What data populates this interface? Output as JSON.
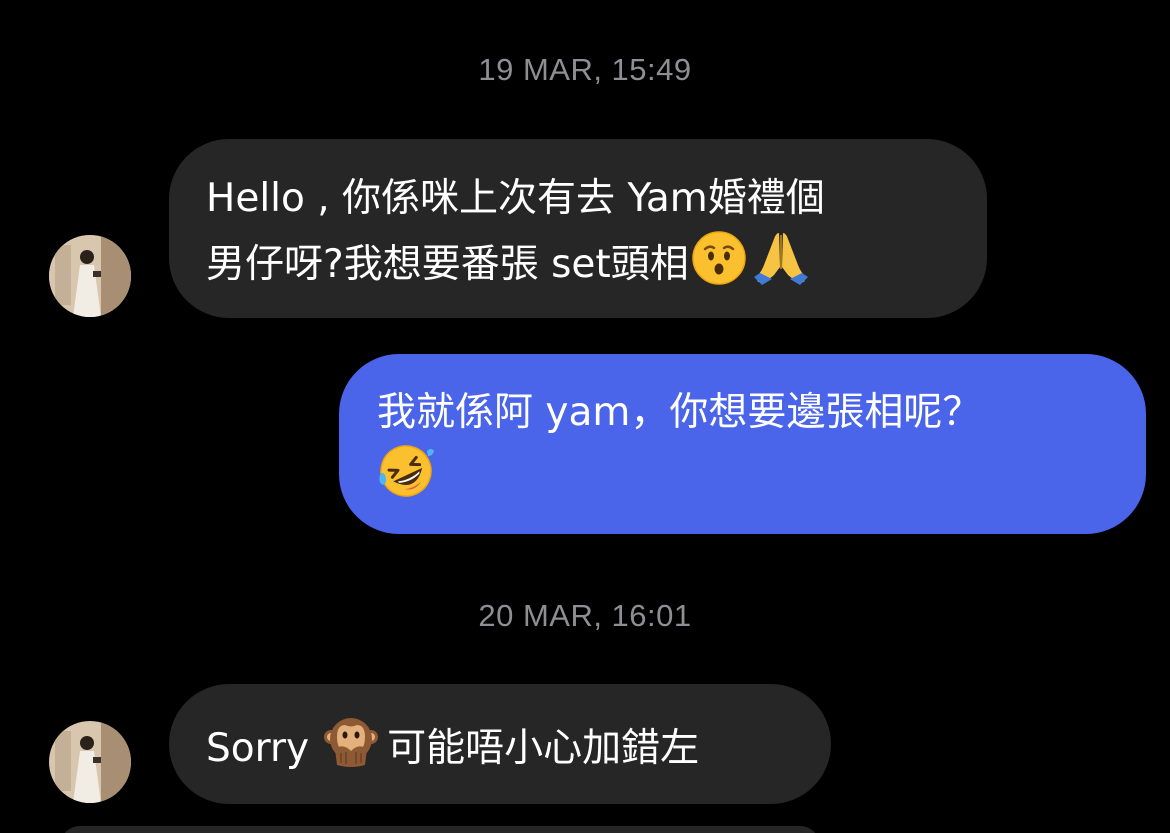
{
  "conversation": {
    "timestamps": [
      "19 MAR, 15:49",
      "20 MAR, 16:01"
    ],
    "messages": [
      {
        "direction": "incoming",
        "line1": "Hello , 你係咪上次有去 Yam婚禮個",
        "line2_text": "男仔呀?我想要番張 set頭相",
        "emojis": [
          "hushed-face",
          "folded-hands"
        ]
      },
      {
        "direction": "outgoing",
        "line1": "我就係阿 yam，你想要邊張相呢？",
        "emojis": [
          "rolling-on-floor-laughing"
        ]
      },
      {
        "direction": "incoming",
        "text_before": "Sorry",
        "text_after": "可能唔小心加錯左",
        "emojis": [
          "speak-no-evil-monkey"
        ]
      }
    ]
  },
  "colors": {
    "background": "#000000",
    "incoming_bubble": "#262626",
    "outgoing_bubble": "#4a64ea",
    "timestamp_text": "#8e8e93",
    "message_text": "#ffffff"
  }
}
